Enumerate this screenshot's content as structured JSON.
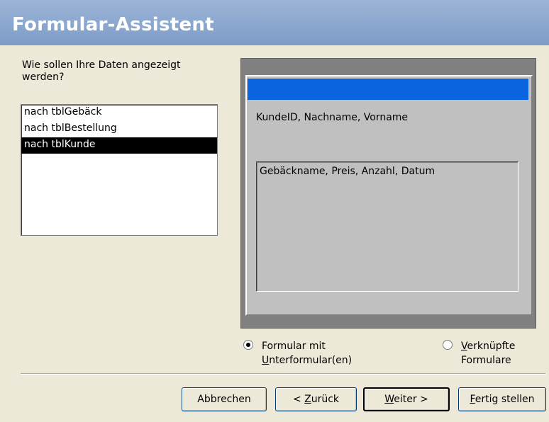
{
  "window": {
    "title": "Formular-Assistent"
  },
  "prompt": "Wie sollen Ihre Daten angezeigt werden?",
  "list": {
    "items": [
      {
        "label": "nach tblGebäck",
        "selected": false
      },
      {
        "label": "nach tblBestellung",
        "selected": false
      },
      {
        "label": "nach tblKunde",
        "selected": true
      }
    ]
  },
  "preview": {
    "main_fields": "KundeID, Nachname, Vorname",
    "subform_fields": "Gebäckname, Preis, Anzahl, Datum"
  },
  "options": {
    "formular_mit_line1": "Formular mit",
    "formular_mit_line2_u": "U",
    "formular_mit_line2_rest": "nterformular(en)",
    "formular_mit_checked": true,
    "verknuepft_line1_u": "V",
    "verknuepft_line1_rest": "erknüpfte",
    "verknuepft_line2": "Formulare",
    "verknuepft_checked": false
  },
  "buttons": {
    "cancel": "Abbrechen",
    "back_prefix": "< ",
    "back_u": "Z",
    "back_rest": "urück",
    "next_u": "W",
    "next_rest": "eiter >",
    "finish_u": "F",
    "finish_rest": "ertig stellen"
  },
  "colors": {
    "title_bar": "#8aa7cf",
    "preview_header": "#0a64e0",
    "selection": "#000000"
  }
}
